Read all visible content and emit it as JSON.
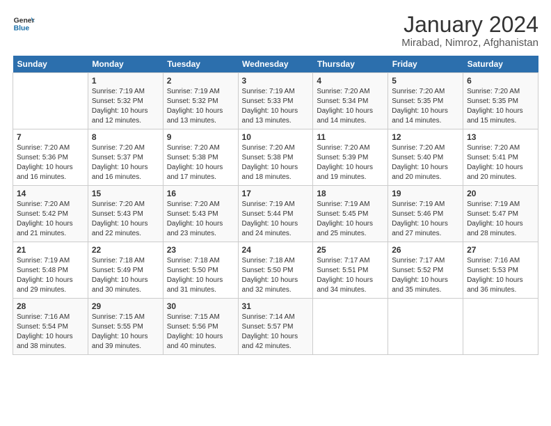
{
  "logo": {
    "line1": "General",
    "line2": "Blue"
  },
  "title": "January 2024",
  "subtitle": "Mirabad, Nimroz, Afghanistan",
  "days_header": [
    "Sunday",
    "Monday",
    "Tuesday",
    "Wednesday",
    "Thursday",
    "Friday",
    "Saturday"
  ],
  "weeks": [
    [
      {
        "day": "",
        "info": ""
      },
      {
        "day": "1",
        "info": "Sunrise: 7:19 AM\nSunset: 5:32 PM\nDaylight: 10 hours\nand 12 minutes."
      },
      {
        "day": "2",
        "info": "Sunrise: 7:19 AM\nSunset: 5:32 PM\nDaylight: 10 hours\nand 13 minutes."
      },
      {
        "day": "3",
        "info": "Sunrise: 7:19 AM\nSunset: 5:33 PM\nDaylight: 10 hours\nand 13 minutes."
      },
      {
        "day": "4",
        "info": "Sunrise: 7:20 AM\nSunset: 5:34 PM\nDaylight: 10 hours\nand 14 minutes."
      },
      {
        "day": "5",
        "info": "Sunrise: 7:20 AM\nSunset: 5:35 PM\nDaylight: 10 hours\nand 14 minutes."
      },
      {
        "day": "6",
        "info": "Sunrise: 7:20 AM\nSunset: 5:35 PM\nDaylight: 10 hours\nand 15 minutes."
      }
    ],
    [
      {
        "day": "7",
        "info": "Sunrise: 7:20 AM\nSunset: 5:36 PM\nDaylight: 10 hours\nand 16 minutes."
      },
      {
        "day": "8",
        "info": "Sunrise: 7:20 AM\nSunset: 5:37 PM\nDaylight: 10 hours\nand 16 minutes."
      },
      {
        "day": "9",
        "info": "Sunrise: 7:20 AM\nSunset: 5:38 PM\nDaylight: 10 hours\nand 17 minutes."
      },
      {
        "day": "10",
        "info": "Sunrise: 7:20 AM\nSunset: 5:38 PM\nDaylight: 10 hours\nand 18 minutes."
      },
      {
        "day": "11",
        "info": "Sunrise: 7:20 AM\nSunset: 5:39 PM\nDaylight: 10 hours\nand 19 minutes."
      },
      {
        "day": "12",
        "info": "Sunrise: 7:20 AM\nSunset: 5:40 PM\nDaylight: 10 hours\nand 20 minutes."
      },
      {
        "day": "13",
        "info": "Sunrise: 7:20 AM\nSunset: 5:41 PM\nDaylight: 10 hours\nand 20 minutes."
      }
    ],
    [
      {
        "day": "14",
        "info": "Sunrise: 7:20 AM\nSunset: 5:42 PM\nDaylight: 10 hours\nand 21 minutes."
      },
      {
        "day": "15",
        "info": "Sunrise: 7:20 AM\nSunset: 5:43 PM\nDaylight: 10 hours\nand 22 minutes."
      },
      {
        "day": "16",
        "info": "Sunrise: 7:20 AM\nSunset: 5:43 PM\nDaylight: 10 hours\nand 23 minutes."
      },
      {
        "day": "17",
        "info": "Sunrise: 7:19 AM\nSunset: 5:44 PM\nDaylight: 10 hours\nand 24 minutes."
      },
      {
        "day": "18",
        "info": "Sunrise: 7:19 AM\nSunset: 5:45 PM\nDaylight: 10 hours\nand 25 minutes."
      },
      {
        "day": "19",
        "info": "Sunrise: 7:19 AM\nSunset: 5:46 PM\nDaylight: 10 hours\nand 27 minutes."
      },
      {
        "day": "20",
        "info": "Sunrise: 7:19 AM\nSunset: 5:47 PM\nDaylight: 10 hours\nand 28 minutes."
      }
    ],
    [
      {
        "day": "21",
        "info": "Sunrise: 7:19 AM\nSunset: 5:48 PM\nDaylight: 10 hours\nand 29 minutes."
      },
      {
        "day": "22",
        "info": "Sunrise: 7:18 AM\nSunset: 5:49 PM\nDaylight: 10 hours\nand 30 minutes."
      },
      {
        "day": "23",
        "info": "Sunrise: 7:18 AM\nSunset: 5:50 PM\nDaylight: 10 hours\nand 31 minutes."
      },
      {
        "day": "24",
        "info": "Sunrise: 7:18 AM\nSunset: 5:50 PM\nDaylight: 10 hours\nand 32 minutes."
      },
      {
        "day": "25",
        "info": "Sunrise: 7:17 AM\nSunset: 5:51 PM\nDaylight: 10 hours\nand 34 minutes."
      },
      {
        "day": "26",
        "info": "Sunrise: 7:17 AM\nSunset: 5:52 PM\nDaylight: 10 hours\nand 35 minutes."
      },
      {
        "day": "27",
        "info": "Sunrise: 7:16 AM\nSunset: 5:53 PM\nDaylight: 10 hours\nand 36 minutes."
      }
    ],
    [
      {
        "day": "28",
        "info": "Sunrise: 7:16 AM\nSunset: 5:54 PM\nDaylight: 10 hours\nand 38 minutes."
      },
      {
        "day": "29",
        "info": "Sunrise: 7:15 AM\nSunset: 5:55 PM\nDaylight: 10 hours\nand 39 minutes."
      },
      {
        "day": "30",
        "info": "Sunrise: 7:15 AM\nSunset: 5:56 PM\nDaylight: 10 hours\nand 40 minutes."
      },
      {
        "day": "31",
        "info": "Sunrise: 7:14 AM\nSunset: 5:57 PM\nDaylight: 10 hours\nand 42 minutes."
      },
      {
        "day": "",
        "info": ""
      },
      {
        "day": "",
        "info": ""
      },
      {
        "day": "",
        "info": ""
      }
    ]
  ]
}
